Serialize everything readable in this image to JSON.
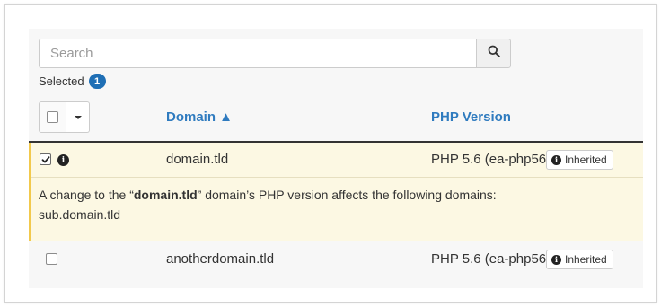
{
  "search": {
    "placeholder": "Search",
    "value": ""
  },
  "selection": {
    "label": "Selected",
    "count": "1"
  },
  "table": {
    "columns": {
      "domain": "Domain ▲",
      "php": "PHP Version"
    },
    "rows": [
      {
        "domain": "domain.tld",
        "php": "PHP 5.6 (ea-php56)",
        "badge": "Inherited",
        "checked": true,
        "notice": {
          "prefix": "A change to the “",
          "domain": "domain.tld",
          "suffix": "” domain’s PHP version affects the following domains:",
          "affected": "sub.domain.tld"
        }
      },
      {
        "domain": "anotherdomain.tld",
        "php": "PHP 5.6 (ea-php56)",
        "badge": "Inherited",
        "checked": false
      }
    ]
  },
  "colors": {
    "accent": "#2f7bbf",
    "badge": "#1f6fb5",
    "highlight_row": "#fcf8e3",
    "highlight_border": "#f2c94c"
  },
  "icons": {
    "search": "search-icon",
    "info": "info-icon",
    "caret": "chevron-down-icon",
    "check": "checkmark-icon"
  }
}
